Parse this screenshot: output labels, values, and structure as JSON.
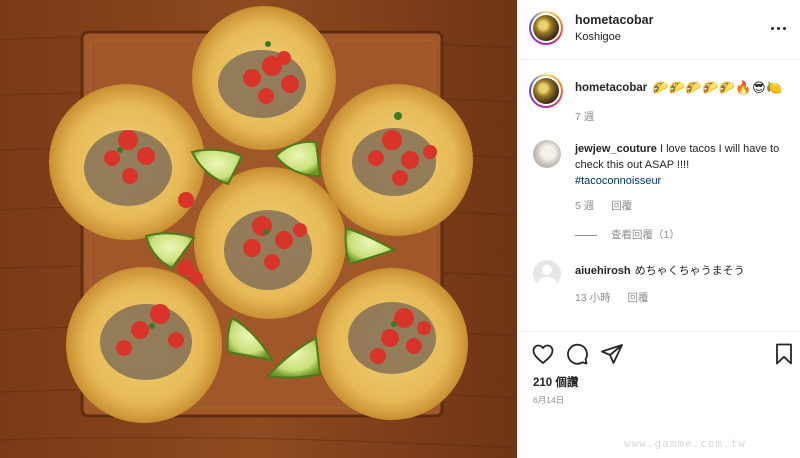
{
  "header": {
    "username": "hometacobar",
    "location": "Koshigoe"
  },
  "caption": {
    "username": "hometacobar",
    "emojis": "🌮🌮🌮🌮🌮🔥😎🍋",
    "time": "7 週"
  },
  "comments": [
    {
      "username": "jewjew_couture",
      "text": "I love tacos I will have to check this out ASAP !!!!",
      "hashtag": "#tacoconnoisseur",
      "time": "5 週",
      "reply_label": "回覆",
      "view_replies": "查看回覆（1）"
    },
    {
      "username": "aiuehirosh",
      "text": "めちゃくちゃうまそう",
      "time": "13 小時",
      "reply_label": "回覆"
    }
  ],
  "actions": {
    "like_icon": "heart-icon",
    "comment_icon": "comment-icon",
    "share_icon": "paper-plane-icon",
    "save_icon": "bookmark-icon"
  },
  "likes": "210 個讚",
  "date": "6月14日",
  "watermark": "www.gamme.com.tw",
  "colors": {
    "text": "#262626",
    "secondary": "#8e8e8e",
    "link": "#00376b",
    "border": "#efefef"
  }
}
